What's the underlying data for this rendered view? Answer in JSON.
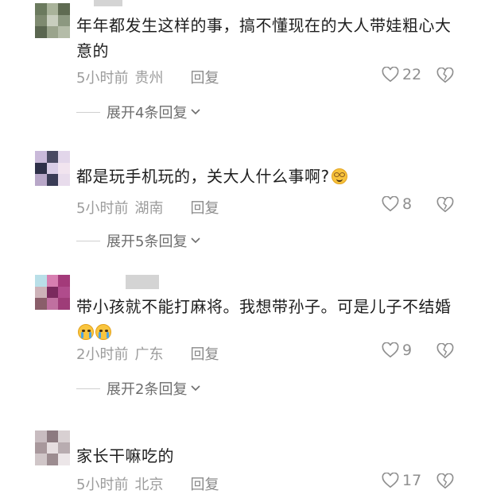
{
  "comments": [
    {
      "text": "年年都发生这样的事，搞不懂现在的大人带娃粗心大意的",
      "time": "5小时前",
      "location": "贵州",
      "reply_label": "回复",
      "likes": "22",
      "expand_label": "展开4条回复",
      "avatar_colors": [
        "#6b7a5e",
        "#a9b39a",
        "#5f6b52",
        "#7e8a70",
        "#c8cebe",
        "#8c9880",
        "#5a6650",
        "#9aa48c",
        "#b4bca8"
      ]
    },
    {
      "text": "都是玩手机玩的，关大人什么事啊?",
      "emoji": "smile-glasses-emoji",
      "time": "5小时前",
      "location": "湖南",
      "reply_label": "回复",
      "likes": "8",
      "expand_label": "展开5条回复",
      "avatar_colors": [
        "#c9b9d9",
        "#4a4a62",
        "#e2d6ea",
        "#2e3048",
        "#d9cde6",
        "#f1e4ef",
        "#b8a7c8",
        "#3a3c56",
        "#e8dcec"
      ]
    },
    {
      "text": "带小孩就不能打麻将。我想带孙子。可是儿子不结婚",
      "emoji": "crying-emoji",
      "time": "2小时前",
      "location": "广东",
      "reply_label": "回复",
      "likes": "9",
      "expand_label": "展开2条回复",
      "avatar_colors": [
        "#b9dfe8",
        "#d77fb1",
        "#a33a7a",
        "#cdb2b8",
        "#7a2a5e",
        "#b04c8c",
        "#8a5e6a",
        "#c070a0",
        "#9e3c78"
      ]
    },
    {
      "text": "家长干嘛吃的",
      "time": "5小时前",
      "location": "北京",
      "reply_label": "回复",
      "likes": "17",
      "avatar_colors": [
        "#c8bcc0",
        "#8c7a80",
        "#d8d0d2",
        "#a8989c",
        "#e6dee0",
        "#b8acb0",
        "#d0c6c8",
        "#9c8c90",
        "#ece6e8"
      ]
    }
  ],
  "colors": {
    "text": "#1e1e1e",
    "meta": "#9c9c9c",
    "expand": "#6d6d6d",
    "icon": "#8f8f8f"
  }
}
